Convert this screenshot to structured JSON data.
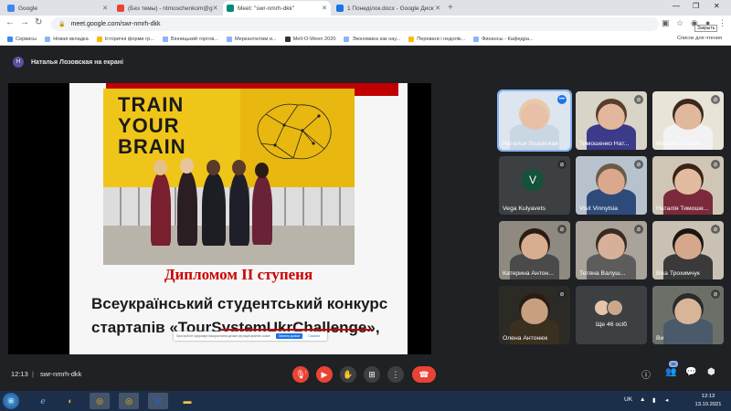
{
  "browser": {
    "tabs": [
      {
        "title": "Google",
        "color": "#4285f4",
        "active": false
      },
      {
        "title": "(Без темы) - ntmoschenkom@g",
        "color": "#ea4335",
        "active": false
      },
      {
        "title": "Meet: \"swr-nmrh-dkk\"",
        "color": "#00897b",
        "active": true
      },
      {
        "title": "1 Понеділок.docx - Google Диск",
        "color": "#1a73e8",
        "active": false
      }
    ],
    "url": "meet.google.com/swr-nmrh-dkk",
    "tooltip": "Закрыть",
    "bookmarks": [
      {
        "label": "Сервисы",
        "type": "apps"
      },
      {
        "label": "Новая вкладка",
        "type": "page"
      },
      {
        "label": "Історичні форми гр...",
        "type": "page"
      },
      {
        "label": "Вінницький торгов...",
        "type": "page"
      },
      {
        "label": "Меркантилізм и...",
        "type": "page"
      },
      {
        "label": "Mell-O-Ween 2020",
        "type": "page"
      },
      {
        "label": "Экономика как нау...",
        "type": "page"
      },
      {
        "label": "Переваги і недолік...",
        "type": "page"
      },
      {
        "label": "Финансы - Кафедра...",
        "type": "page"
      }
    ],
    "reading_list": "Список для чтения"
  },
  "meet": {
    "presenter_initial": "Н",
    "presenter_text": "Наталья Лозовская на екрані",
    "slide": {
      "brand_lines": [
        "TRAIN",
        "YOUR",
        "BRAIN"
      ],
      "diploma": "Дипломом ІІ ступеня",
      "contest_line1": "Всеукраїнський студентський конкурс",
      "contest_line2": "стартапів «TourSystemUkrChallenge»,"
    },
    "cookie": {
      "text": "Пристрій не підтримує використання деяких функцій файлів cookie",
      "btn": "Змінити дозвол",
      "btn2": "Сховати"
    },
    "participants": [
      {
        "name": "Наталья Лозовская",
        "speaking": true,
        "skin": "#e8c0a8",
        "hair": "#e9c9a9",
        "shirt": "#c9d6e4",
        "bg": "#dde6ef"
      },
      {
        "name": "Тимошенко Нат...",
        "speaking": false,
        "skin": "#e2b79c",
        "hair": "#5a3d2b",
        "shirt": "#3b3b8a",
        "bg": "#d9d4c8"
      },
      {
        "name": "Михаил Потапч...",
        "speaking": false,
        "skin": "#e0b89c",
        "hair": "#3a2a1e",
        "shirt": "#f2f2f2",
        "bg": "#e9e4d8"
      },
      {
        "name": "Vega Kulyavets",
        "speaking": false,
        "avatar": "V"
      },
      {
        "name": "Visit Vinnytsia",
        "speaking": false,
        "skin": "#dba88e",
        "hair": "#6a5a4a",
        "shirt": "#2d4a7a",
        "bg": "#b8c2cc"
      },
      {
        "name": "Наталія Тимоше...",
        "speaking": false,
        "skin": "#e3bba0",
        "hair": "#3a2418",
        "shirt": "#7a2a3a",
        "bg": "#cfc6b6"
      },
      {
        "name": "Катерина Антон...",
        "speaking": false,
        "skin": "#d9ad90",
        "hair": "#2a1c14",
        "shirt": "#4a4a4a",
        "bg": "#8e8a80"
      },
      {
        "name": "Тетяна Валуш...",
        "speaking": false,
        "skin": "#d7b09a",
        "hair": "#3a2a20",
        "shirt": "#5c5c5c",
        "bg": "#a9a39a"
      },
      {
        "name": "Віка Трохимчук",
        "speaking": false,
        "skin": "#d5a88c",
        "hair": "#1c1410",
        "shirt": "#3a3a3a",
        "bg": "#c8c1b4"
      },
      {
        "name": "Олена Антонюк",
        "speaking": false,
        "skin": "#c8a080",
        "hair": "#2a1c14",
        "shirt": "#3a3020",
        "bg": "#2c2a24"
      },
      {
        "name": "Ще 46 осіб",
        "speaking": false,
        "more": true
      },
      {
        "name": "Ви",
        "speaking": false,
        "skin": "#d8b498",
        "hair": "#2a2a2a",
        "shirt": "#4a5a6a",
        "bg": "#6a7068"
      }
    ],
    "time": "12:13",
    "separator": "|",
    "meeting_code": "swr-nmrh-dkk",
    "participant_count": "58",
    "mic_badge": "!"
  },
  "taskbar": {
    "lang": "UK",
    "time": "12:13",
    "date": "13.10.2021"
  }
}
